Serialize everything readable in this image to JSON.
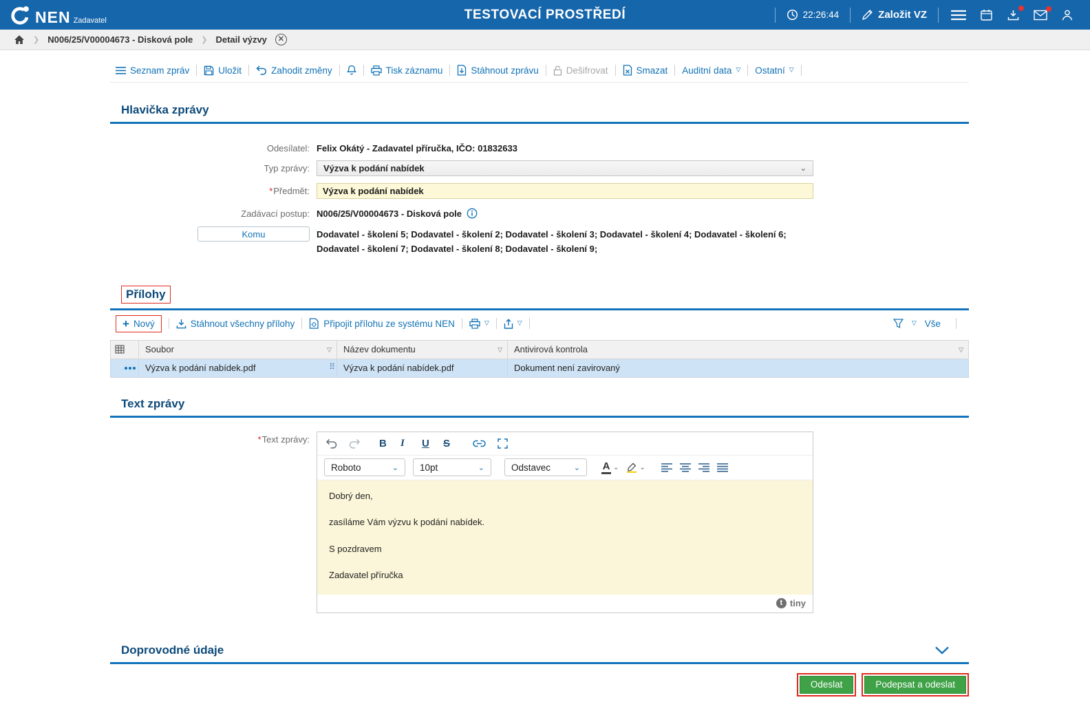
{
  "topbar": {
    "brand": "NEN",
    "brand_sub": "Zadavatel",
    "environment": "TESTOVACÍ PROSTŘEDÍ",
    "time": "22:26:44",
    "create_vz": "Založit VZ"
  },
  "breadcrumb": {
    "item1": "N006/25/V00004673 - Disková pole",
    "item2": "Detail výzvy"
  },
  "toolbar": {
    "list_messages": "Seznam zpráv",
    "save": "Uložit",
    "discard": "Zahodit změny",
    "print": "Tisk záznamu",
    "download_message": "Stáhnout zprávu",
    "decrypt": "Dešifrovat",
    "delete": "Smazat",
    "audit": "Auditní data",
    "other": "Ostatní"
  },
  "header_section": {
    "title": "Hlavička zprávy",
    "required_marker": "*",
    "sender_label": "Odesílatel:",
    "sender_value": "Felix Okátý - Zadavatel příručka, IČO: 01832633",
    "type_label": "Typ zprávy:",
    "type_value": "Výzva k podání nabídek",
    "subject_label": "Předmět:",
    "subject_value": "Výzva k podání nabídek",
    "procedure_label": "Zadávací postup:",
    "procedure_value": "N006/25/V00004673 - Disková pole",
    "recipients_button": "Komu",
    "recipients_value": "Dodavatel - školení 5; Dodavatel - školení 2; Dodavatel - školení 3; Dodavatel - školení 4; Dodavatel - školení 6; Dodavatel - školení 7; Dodavatel - školení 8; Dodavatel - školení 9;"
  },
  "attachments": {
    "title": "Přílohy",
    "new": "Nový",
    "download_all": "Stáhnout všechny přílohy",
    "attach_from_nen": "Připojit přílohu ze systému NEN",
    "all_filter": "Vše",
    "columns": {
      "file": "Soubor",
      "doc_name": "Název dokumentu",
      "antivirus": "Antivirová kontrola"
    },
    "row": {
      "file": "Výzva k podání nabídek.pdf",
      "doc_name": "Výzva k podání nabídek.pdf",
      "antivirus": "Dokument není zavirovaný"
    }
  },
  "message": {
    "title": "Text zprávy",
    "label": "Text zprávy:",
    "editor": {
      "font_name": "Roboto",
      "font_size": "10pt",
      "block_format": "Odstavec",
      "line1": "Dobrý den,",
      "line2": "zasíláme Vám výzvu k podání nabídek.",
      "line3": "S pozdravem",
      "line4": "Zadavatel příručka",
      "brand": "tiny"
    }
  },
  "extra_section": {
    "title": "Doprovodné údaje"
  },
  "actions": {
    "send": "Odeslat",
    "sign_and_send": "Podepsat a odeslat"
  },
  "colors": {
    "topbar_blue": "#1666ab",
    "link_blue": "#1272b6",
    "section_blue": "#0d4a7a",
    "rule_blue": "#1273bd",
    "highlight_yellow": "#fbf6d9",
    "selected_row": "#cfe3f6",
    "button_green": "#3fa247",
    "alert_red": "#dd2b1c"
  }
}
